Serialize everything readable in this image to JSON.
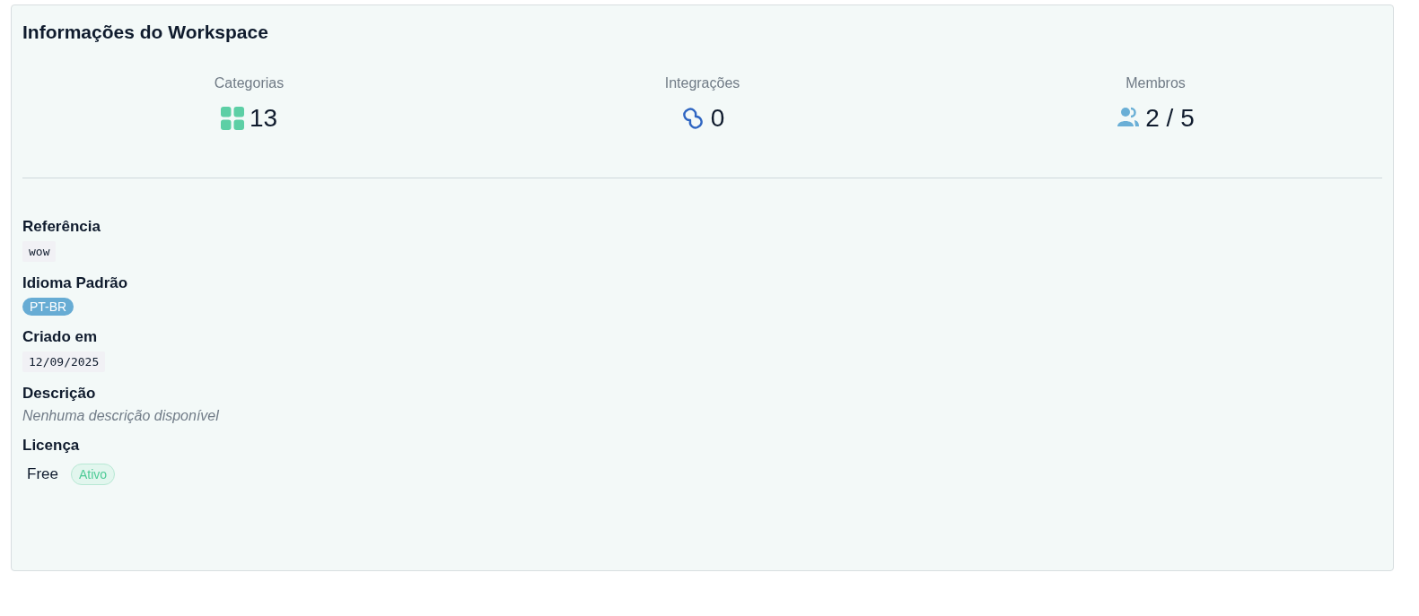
{
  "card": {
    "title": "Informações do Workspace"
  },
  "stats": [
    {
      "label": "Categorias",
      "kind": "grid",
      "value": "13"
    },
    {
      "label": "Integrações",
      "kind": "link",
      "value": "0"
    },
    {
      "label": "Membros",
      "kind": "users",
      "value": "2 / 5"
    }
  ],
  "fields": [
    {
      "label": "Referência",
      "kind": "code",
      "value": "wow"
    },
    {
      "label": "Idioma Padrão",
      "kind": "badge",
      "value": "PT-BR"
    },
    {
      "label": "Criado em",
      "kind": "code",
      "value": "12/09/2025"
    },
    {
      "label": "Descrição",
      "kind": "muted",
      "value": "Nenhuma descrição disponível"
    },
    {
      "label": "Licença",
      "kind": "license",
      "value": "Free",
      "status": "Ativo"
    }
  ]
}
